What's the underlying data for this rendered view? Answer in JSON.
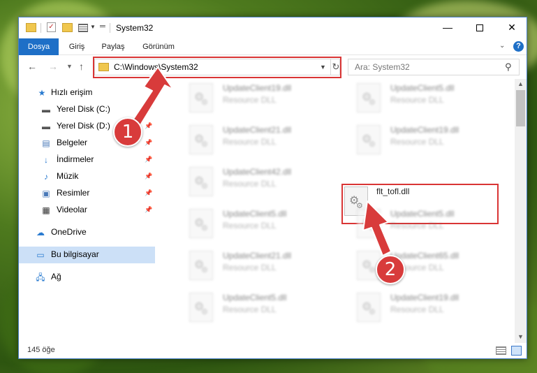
{
  "window": {
    "title": "System32",
    "controls": {
      "minimize": "—",
      "maximize": "",
      "close": "✕"
    }
  },
  "ribbon": {
    "tabs": [
      "Dosya",
      "Giriş",
      "Paylaş",
      "Görünüm"
    ],
    "help": "?"
  },
  "address": {
    "path": "C:\\Windows\\System32",
    "search_placeholder": "Ara: System32"
  },
  "sidebar": {
    "quick_access": "Hızlı erişim",
    "items": [
      {
        "label": "Yerel Disk (C:)",
        "icon": "drive-icon",
        "pinned": true
      },
      {
        "label": "Yerel Disk (D:)",
        "icon": "drive-icon",
        "pinned": true
      },
      {
        "label": "Belgeler",
        "icon": "documents-icon",
        "pinned": true
      },
      {
        "label": "İndirmeler",
        "icon": "download-icon",
        "pinned": true
      },
      {
        "label": "Müzik",
        "icon": "music-icon",
        "pinned": true
      },
      {
        "label": "Resimler",
        "icon": "pictures-icon",
        "pinned": true
      },
      {
        "label": "Videolar",
        "icon": "videos-icon",
        "pinned": true
      }
    ],
    "onedrive": "OneDrive",
    "this_pc": "Bu bilgisayar",
    "network": "Ağ"
  },
  "files": {
    "left_column": [
      {
        "name": "UpdateClient19.dll",
        "type": "Resource DLL"
      },
      {
        "name": "UpdateClient21.dll",
        "type": "Resource DLL"
      },
      {
        "name": "UpdateClient42.dll",
        "type": "Resource DLL"
      },
      {
        "name": "UpdateClient5.dll",
        "type": "Resource DLL"
      },
      {
        "name": "UpdateClient21.dll",
        "type": "Resource DLL"
      },
      {
        "name": "UpdateClient5.dll",
        "type": "Resource DLL"
      }
    ],
    "right_column": [
      {
        "name": "UpdateClient5.dll",
        "type": "Resource DLL"
      },
      {
        "name": "UpdateClient19.dll",
        "type": "Resource DLL"
      },
      {
        "name": "flt_tofl.dll",
        "type": ""
      },
      {
        "name": "UpdateClient5.dll",
        "type": "Resource DLL"
      },
      {
        "name": "UpdateClient65.dll",
        "type": "Resource DLL"
      },
      {
        "name": "UpdateClient19.dll",
        "type": "Resource DLL"
      }
    ]
  },
  "status": {
    "count": "145 öğe"
  },
  "annotations": {
    "step1": "1",
    "step2": "2",
    "color": "#d93535"
  }
}
